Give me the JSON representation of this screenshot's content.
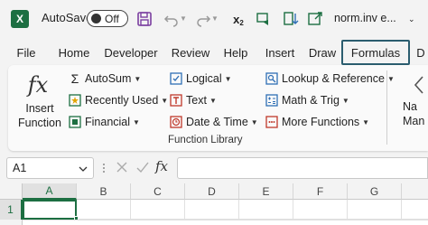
{
  "titlebar": {
    "app_logo": "X",
    "autosave_label": "AutoSave",
    "autosave_state": "Off",
    "filename": "norm.inv e...",
    "icons": [
      "save-icon",
      "undo-icon",
      "redo-icon",
      "subscript-icon",
      "chart-icon",
      "sort-icon",
      "export-icon"
    ]
  },
  "tabs": [
    "File",
    "Home",
    "Developer",
    "Review",
    "Help",
    "Insert",
    "Draw",
    "Formulas",
    "D"
  ],
  "active_tab": "Formulas",
  "ribbon": {
    "insert_function_symbol": "fx",
    "insert_function_line1": "Insert",
    "insert_function_line2": "Function",
    "autosum": "AutoSum",
    "recently_used": "Recently Used",
    "financial": "Financial",
    "logical": "Logical",
    "text": "Text",
    "date_time": "Date & Time",
    "lookup_reference": "Lookup & Reference",
    "math_trig": "Math & Trig",
    "more_functions": "More Functions",
    "group_label": "Function Library",
    "name_manager_line1": "Na",
    "name_manager_line2": "Man"
  },
  "formula_bar": {
    "name_box": "A1",
    "fx_symbol": "fx",
    "value": ""
  },
  "grid": {
    "columns": [
      "A",
      "B",
      "C",
      "D",
      "E",
      "F",
      "G"
    ],
    "rows": [
      "1"
    ],
    "active_cell": "A1"
  },
  "colors": {
    "excel_green": "#1d6f42",
    "active_tab_border": "#2b5d6f",
    "save_purple": "#7b3fa0"
  }
}
